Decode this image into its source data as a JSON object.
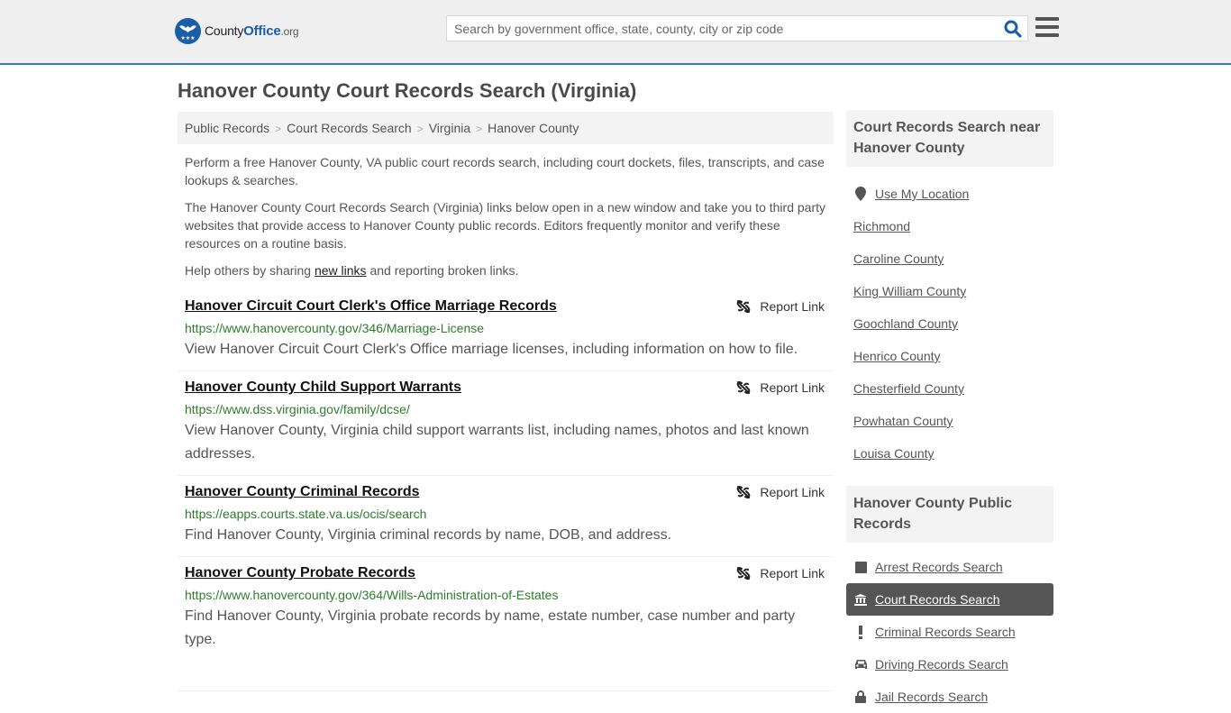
{
  "header": {
    "logo": {
      "name": "County",
      "brand": "Office",
      "tld": ".org"
    },
    "search": {
      "placeholder": "Search by government office, state, county, city or zip code",
      "value": ""
    },
    "accent_color": "#3a7bab"
  },
  "page_title": "Hanover County Court Records Search (Virginia)",
  "breadcrumb": [
    "Public Records",
    "Court Records Search",
    "Virginia",
    "Hanover County"
  ],
  "intro": {
    "p1": "Perform a free Hanover County, VA public court records search, including court dockets, files, transcripts, and case lookups & searches.",
    "p2": "The Hanover County Court Records Search (Virginia) links below open in a new window and take you to third party websites that provide access to Hanover County public records. Editors frequently monitor and verify these resources on a routine basis.",
    "p3_before": "Help others by sharing ",
    "p3_link": "new links",
    "p3_after": " and reporting broken links."
  },
  "report_label": "Report Link",
  "results": [
    {
      "title": "Hanover Circuit Court Clerk's Office Marriage Records",
      "url": "https://www.hanovercounty.gov/346/Marriage-License",
      "description": "View Hanover Circuit Court Clerk's Office marriage licenses, including information on how to file."
    },
    {
      "title": "Hanover County Child Support Warrants",
      "url": "https://www.dss.virginia.gov/family/dcse/",
      "description": "View Hanover County, Virginia child support warrants list, including names, photos and last known addresses."
    },
    {
      "title": "Hanover County Criminal Records",
      "url": "https://eapps.courts.state.va.us/ocis/search",
      "description": "Find Hanover County, Virginia criminal records by name, DOB, and address."
    },
    {
      "title": "Hanover County Probate Records",
      "url": "https://www.hanovercounty.gov/364/Wills-Administration-of-Estates",
      "description": "Find Hanover County, Virginia probate records by name, estate number, case number and party type."
    }
  ],
  "sidebar": {
    "nearby_heading": "Court Records Search near Hanover County",
    "use_location": "Use My Location",
    "nearby": [
      "Richmond",
      "Caroline County",
      "King William County",
      "Goochland County",
      "Henrico County",
      "Chesterfield County",
      "Powhatan County",
      "Louisa County"
    ],
    "public_heading": "Hanover County Public Records",
    "public_records": [
      {
        "label": "Arrest Records Search",
        "icon": "square-icon",
        "active": false
      },
      {
        "label": "Court Records Search",
        "icon": "courthouse-icon",
        "active": true
      },
      {
        "label": "Criminal Records Search",
        "icon": "exclamation-icon",
        "active": false
      },
      {
        "label": "Driving Records Search",
        "icon": "car-icon",
        "active": false
      },
      {
        "label": "Jail Records Search",
        "icon": "lock-icon",
        "active": false
      }
    ]
  }
}
